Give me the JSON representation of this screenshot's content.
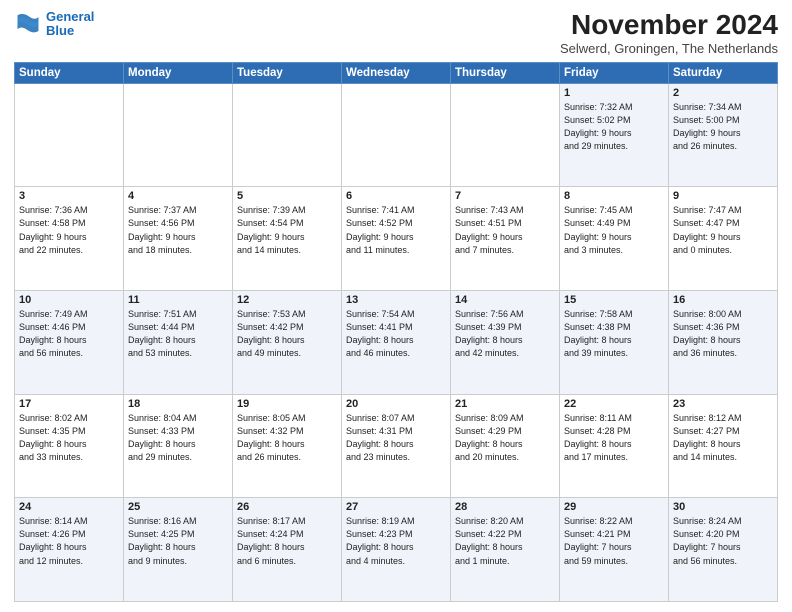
{
  "header": {
    "logo_line1": "General",
    "logo_line2": "Blue",
    "month": "November 2024",
    "location": "Selwerd, Groningen, The Netherlands"
  },
  "weekdays": [
    "Sunday",
    "Monday",
    "Tuesday",
    "Wednesday",
    "Thursday",
    "Friday",
    "Saturday"
  ],
  "weeks": [
    [
      {
        "day": "",
        "info": ""
      },
      {
        "day": "",
        "info": ""
      },
      {
        "day": "",
        "info": ""
      },
      {
        "day": "",
        "info": ""
      },
      {
        "day": "",
        "info": ""
      },
      {
        "day": "1",
        "info": "Sunrise: 7:32 AM\nSunset: 5:02 PM\nDaylight: 9 hours\nand 29 minutes."
      },
      {
        "day": "2",
        "info": "Sunrise: 7:34 AM\nSunset: 5:00 PM\nDaylight: 9 hours\nand 26 minutes."
      }
    ],
    [
      {
        "day": "3",
        "info": "Sunrise: 7:36 AM\nSunset: 4:58 PM\nDaylight: 9 hours\nand 22 minutes."
      },
      {
        "day": "4",
        "info": "Sunrise: 7:37 AM\nSunset: 4:56 PM\nDaylight: 9 hours\nand 18 minutes."
      },
      {
        "day": "5",
        "info": "Sunrise: 7:39 AM\nSunset: 4:54 PM\nDaylight: 9 hours\nand 14 minutes."
      },
      {
        "day": "6",
        "info": "Sunrise: 7:41 AM\nSunset: 4:52 PM\nDaylight: 9 hours\nand 11 minutes."
      },
      {
        "day": "7",
        "info": "Sunrise: 7:43 AM\nSunset: 4:51 PM\nDaylight: 9 hours\nand 7 minutes."
      },
      {
        "day": "8",
        "info": "Sunrise: 7:45 AM\nSunset: 4:49 PM\nDaylight: 9 hours\nand 3 minutes."
      },
      {
        "day": "9",
        "info": "Sunrise: 7:47 AM\nSunset: 4:47 PM\nDaylight: 9 hours\nand 0 minutes."
      }
    ],
    [
      {
        "day": "10",
        "info": "Sunrise: 7:49 AM\nSunset: 4:46 PM\nDaylight: 8 hours\nand 56 minutes."
      },
      {
        "day": "11",
        "info": "Sunrise: 7:51 AM\nSunset: 4:44 PM\nDaylight: 8 hours\nand 53 minutes."
      },
      {
        "day": "12",
        "info": "Sunrise: 7:53 AM\nSunset: 4:42 PM\nDaylight: 8 hours\nand 49 minutes."
      },
      {
        "day": "13",
        "info": "Sunrise: 7:54 AM\nSunset: 4:41 PM\nDaylight: 8 hours\nand 46 minutes."
      },
      {
        "day": "14",
        "info": "Sunrise: 7:56 AM\nSunset: 4:39 PM\nDaylight: 8 hours\nand 42 minutes."
      },
      {
        "day": "15",
        "info": "Sunrise: 7:58 AM\nSunset: 4:38 PM\nDaylight: 8 hours\nand 39 minutes."
      },
      {
        "day": "16",
        "info": "Sunrise: 8:00 AM\nSunset: 4:36 PM\nDaylight: 8 hours\nand 36 minutes."
      }
    ],
    [
      {
        "day": "17",
        "info": "Sunrise: 8:02 AM\nSunset: 4:35 PM\nDaylight: 8 hours\nand 33 minutes."
      },
      {
        "day": "18",
        "info": "Sunrise: 8:04 AM\nSunset: 4:33 PM\nDaylight: 8 hours\nand 29 minutes."
      },
      {
        "day": "19",
        "info": "Sunrise: 8:05 AM\nSunset: 4:32 PM\nDaylight: 8 hours\nand 26 minutes."
      },
      {
        "day": "20",
        "info": "Sunrise: 8:07 AM\nSunset: 4:31 PM\nDaylight: 8 hours\nand 23 minutes."
      },
      {
        "day": "21",
        "info": "Sunrise: 8:09 AM\nSunset: 4:29 PM\nDaylight: 8 hours\nand 20 minutes."
      },
      {
        "day": "22",
        "info": "Sunrise: 8:11 AM\nSunset: 4:28 PM\nDaylight: 8 hours\nand 17 minutes."
      },
      {
        "day": "23",
        "info": "Sunrise: 8:12 AM\nSunset: 4:27 PM\nDaylight: 8 hours\nand 14 minutes."
      }
    ],
    [
      {
        "day": "24",
        "info": "Sunrise: 8:14 AM\nSunset: 4:26 PM\nDaylight: 8 hours\nand 12 minutes."
      },
      {
        "day": "25",
        "info": "Sunrise: 8:16 AM\nSunset: 4:25 PM\nDaylight: 8 hours\nand 9 minutes."
      },
      {
        "day": "26",
        "info": "Sunrise: 8:17 AM\nSunset: 4:24 PM\nDaylight: 8 hours\nand 6 minutes."
      },
      {
        "day": "27",
        "info": "Sunrise: 8:19 AM\nSunset: 4:23 PM\nDaylight: 8 hours\nand 4 minutes."
      },
      {
        "day": "28",
        "info": "Sunrise: 8:20 AM\nSunset: 4:22 PM\nDaylight: 8 hours\nand 1 minute."
      },
      {
        "day": "29",
        "info": "Sunrise: 8:22 AM\nSunset: 4:21 PM\nDaylight: 7 hours\nand 59 minutes."
      },
      {
        "day": "30",
        "info": "Sunrise: 8:24 AM\nSunset: 4:20 PM\nDaylight: 7 hours\nand 56 minutes."
      }
    ]
  ]
}
